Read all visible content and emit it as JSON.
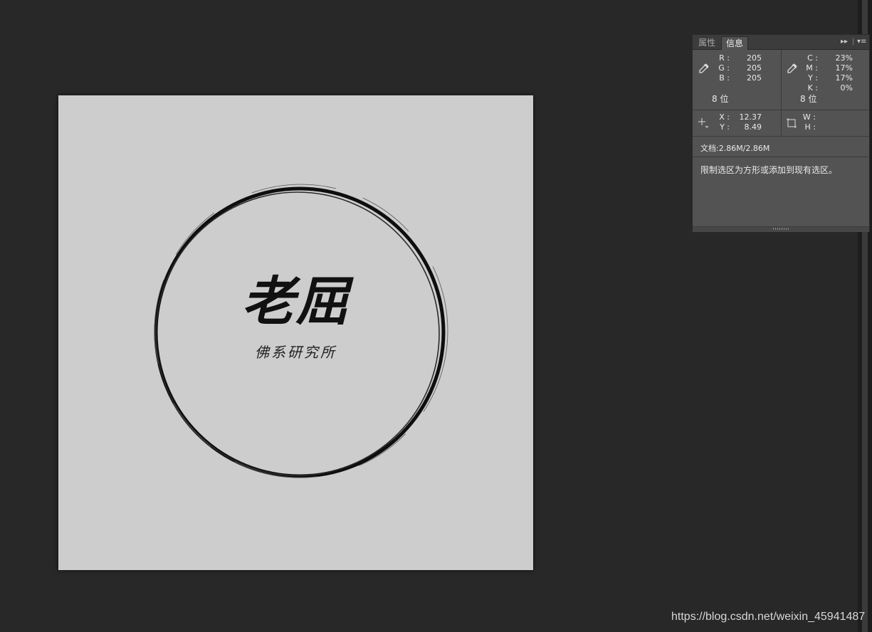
{
  "panel": {
    "tabs": {
      "properties": "属性",
      "info": "信息"
    },
    "rgb": {
      "labels": [
        "R :",
        "G :",
        "B :"
      ],
      "values": [
        "205",
        "205",
        "205"
      ],
      "bits": "8 位"
    },
    "cmyk": {
      "labels": [
        "C :",
        "M :",
        "Y :",
        "K :"
      ],
      "values": [
        "23%",
        "17%",
        "17%",
        "0%"
      ],
      "bits": "8 位"
    },
    "position": {
      "labels": [
        "X :",
        "Y :"
      ],
      "values": [
        "12.37",
        "8.49"
      ]
    },
    "size": {
      "labels": [
        "W :",
        "H :"
      ]
    },
    "doc_info": "文档:2.86M/2.86M",
    "hint": "限制选区为方形或添加到现有选区。"
  },
  "document": {
    "main_text": "老屈",
    "sub_text": "佛系研究所",
    "background_color": "#cdcdcd"
  },
  "watermark": "https://blog.csdn.net/weixin_45941487",
  "icons": [
    "eyedropper-icon",
    "crosshair-icon",
    "selection-size-icon",
    "panel-collapse-icon",
    "panel-menu-icon"
  ]
}
